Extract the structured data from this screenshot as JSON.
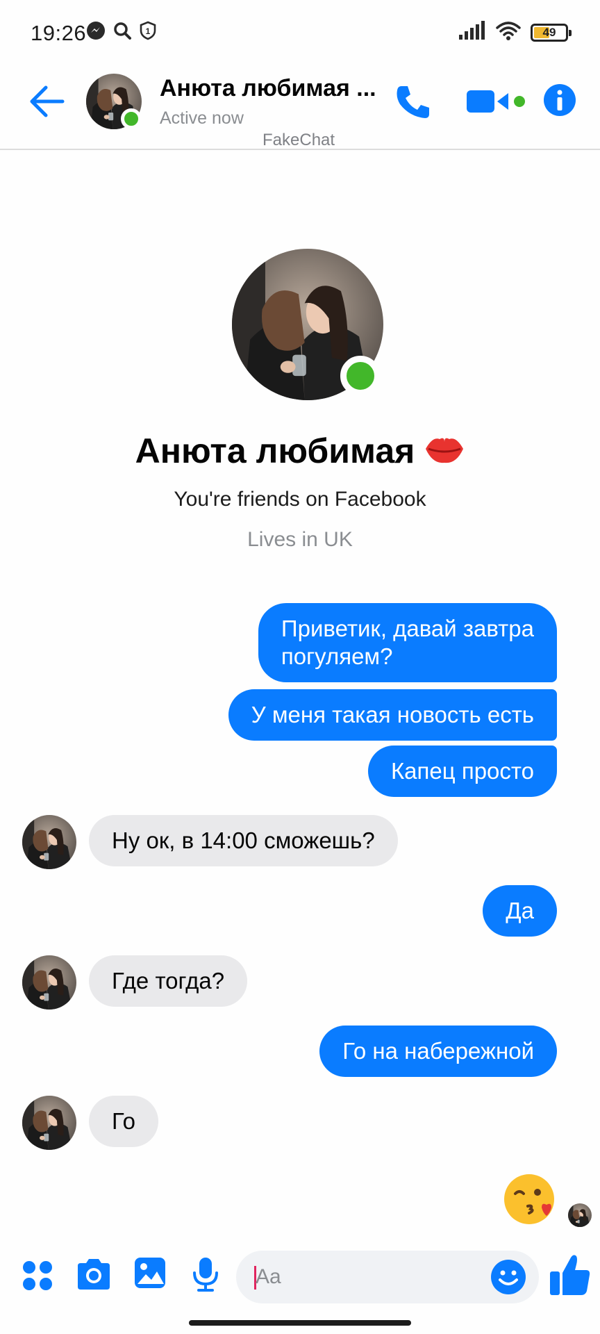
{
  "status_bar": {
    "time": "19:26",
    "battery": "49",
    "battery_level": 0.49,
    "icons_left": [
      "messenger-notification-icon",
      "search-icon",
      "shield-icon"
    ],
    "icons_right": [
      "signal-icon",
      "wifi-icon",
      "battery-icon"
    ]
  },
  "header": {
    "contact_name": "Анюта любимая ...",
    "status": "Active now",
    "watermark": "FakeChat",
    "actions": [
      "back-icon",
      "phone-icon",
      "video-camera-icon",
      "info-icon"
    ]
  },
  "profile": {
    "name": "Анюта любимая",
    "name_emoji": "lips-icon",
    "friends_text": "You're friends on Facebook",
    "lives_text": "Lives in UK"
  },
  "messages": [
    {
      "direction": "out",
      "lines": [
        "Приветик, давай завтра",
        "погуляем?"
      ]
    },
    {
      "direction": "out",
      "text": "У меня такая новость есть"
    },
    {
      "direction": "out",
      "text": "Капец просто"
    },
    {
      "direction": "in",
      "text": "Ну ок, в 14:00 сможешь?"
    },
    {
      "direction": "out",
      "text": "Да"
    },
    {
      "direction": "in",
      "text": "Где тогда?"
    },
    {
      "direction": "out",
      "text": "Го на набережной"
    },
    {
      "direction": "in",
      "text": "Го"
    }
  ],
  "last_reaction": "kissing-face-with-heart-emoji",
  "composer": {
    "placeholder": "Aa",
    "value": "",
    "actions": [
      "menu-dots-icon",
      "camera-icon",
      "gallery-icon",
      "microphone-icon",
      "emoji-icon",
      "like-icon"
    ]
  },
  "colors": {
    "accent": "#0a7cff",
    "online": "#42b72a",
    "incoming_bubble": "#e9e9eb",
    "muted_text": "#8a8d91"
  }
}
